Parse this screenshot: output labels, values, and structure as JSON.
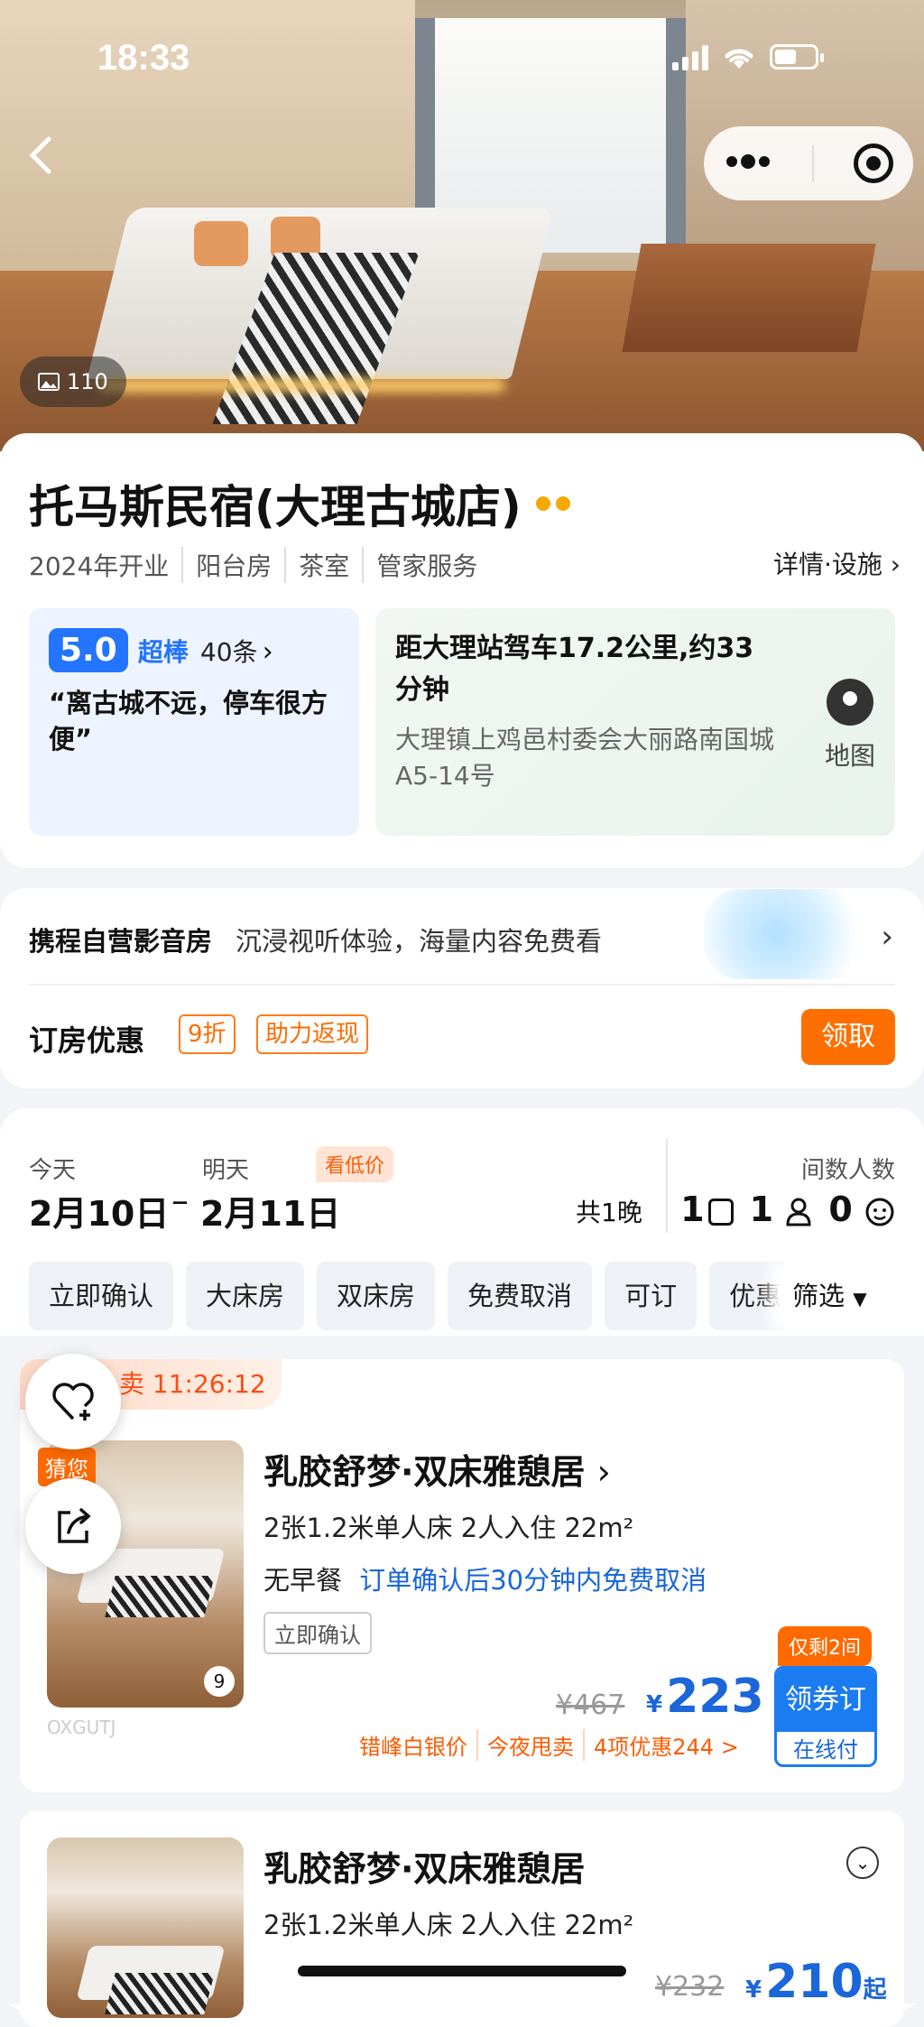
{
  "status": {
    "time": "18:33"
  },
  "gallery": {
    "photo_count": "110"
  },
  "hotel": {
    "name": "托马斯民宿(大理古城店)",
    "tags": [
      "2024年开业",
      "阳台房",
      "茶室",
      "管家服务"
    ],
    "detail_link": "详情·设施"
  },
  "review": {
    "score": "5.0",
    "score_word": "超棒",
    "count": "40条",
    "quote": "“离古城不远，停车很方便”"
  },
  "location": {
    "distance": "距大理站驾车17.2公里,约33分钟",
    "address": "大理镇上鸡邑村委会大丽路南国城A5-14号",
    "map_label": "地图"
  },
  "promo": {
    "title": "携程自营影音房",
    "desc": "沉浸视听体验，海量内容免费看"
  },
  "coupon": {
    "label": "订房优惠",
    "tags": [
      "9折",
      "助力返现"
    ],
    "button": "领取"
  },
  "dates": {
    "checkin_label": "今天",
    "checkout_label": "明天",
    "low_price_tag": "看低价",
    "checkin": "2月10日",
    "dash": "–",
    "checkout": "2月11日",
    "nights": "共1晚",
    "guest_label": "间数人数",
    "rooms": "1",
    "adults": "1",
    "children": "0"
  },
  "filters": {
    "chips": [
      "立即确认",
      "大床房",
      "双床房",
      "免费取消",
      "可订",
      "优惠"
    ],
    "filter_label": "筛选"
  },
  "rooms": [
    {
      "flash_sale": "卖 11:26:12",
      "guess_tag": "猜您",
      "image_count": "9",
      "watermark": "OXGUTJ",
      "name": "乳胶舒梦·双床雅憩居",
      "spec": "2张1.2米单人床  2人入住  22m²",
      "breakfast": "无早餐",
      "cancel": "订单确认后30分钟内免费取消",
      "instant": "立即确认",
      "remaining": "仅剩2间",
      "old_price": "¥467",
      "currency": "¥",
      "price": "223",
      "book": "领券订",
      "pay": "在线付",
      "deals": [
        "错峰白银价",
        "今夜甩卖",
        "4项优惠244 >"
      ]
    },
    {
      "name": "乳胶舒梦·双床雅憩居",
      "spec": "2张1.2米单人床  2人入住  22m²",
      "old_price": "¥232",
      "currency": "¥",
      "price": "210",
      "price_suffix": "起"
    }
  ]
}
